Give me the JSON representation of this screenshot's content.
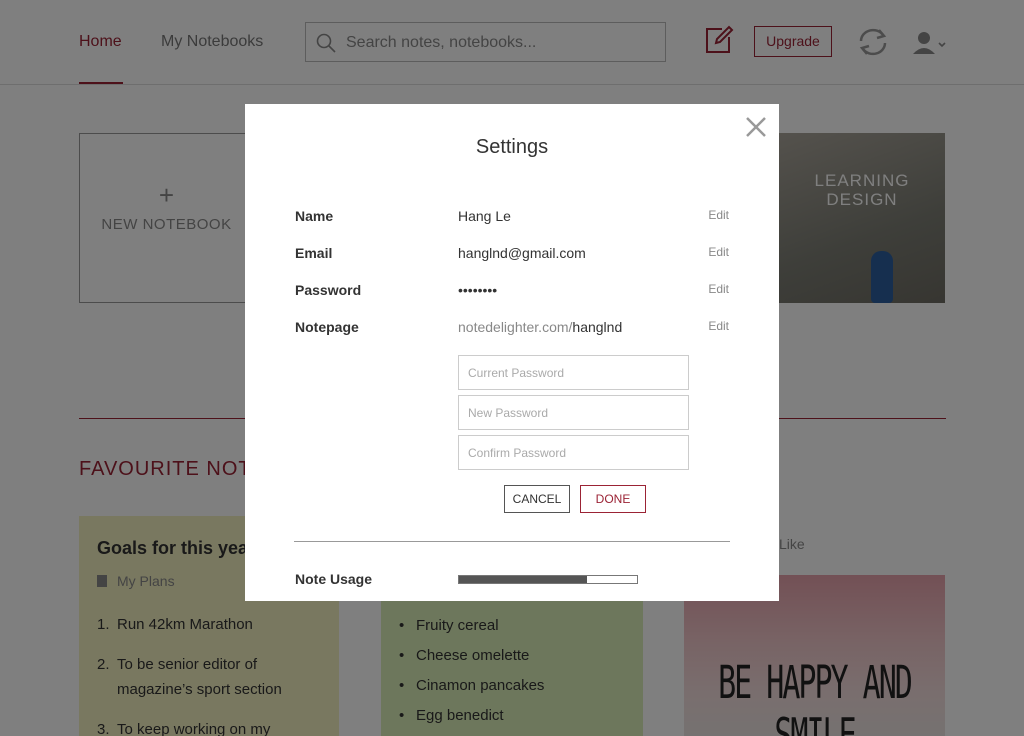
{
  "header": {
    "nav": {
      "home": "Home",
      "notebooks": "My Notebooks"
    },
    "search_placeholder": "Search notes, notebooks...",
    "upgrade_label": "Upgrade"
  },
  "notebooks": {
    "new_plus": "+",
    "new_label": "NEW NOTEBOOK",
    "learning_line1": "LEARNING",
    "learning_line2": "DESIGN"
  },
  "favourites": {
    "title": "FAVOURITE NOTE",
    "card1": {
      "title": "Goals for this year",
      "notebook": "My Plans",
      "items": [
        {
          "n": "1.",
          "text": "Run 42km Marathon"
        },
        {
          "n": "2.",
          "text": "To be senior editor of magazine’s  sport section"
        },
        {
          "n": "3.",
          "text": "To keep working on my"
        }
      ]
    },
    "card2": {
      "items": [
        "Fruity cereal",
        "Cheese omelette",
        "Cinamon pancakes",
        "Egg benedict"
      ]
    },
    "card3": {
      "like": "Like",
      "caption": "BE HAPPY AND SMILE"
    }
  },
  "settings": {
    "title": "Settings",
    "rows": {
      "name": {
        "label": "Name",
        "value": "Hang Le",
        "edit": "Edit"
      },
      "email": {
        "label": "Email",
        "value": "hanglnd@gmail.com",
        "edit": "Edit"
      },
      "password": {
        "label": "Password",
        "value": "••••••••",
        "edit": "Edit"
      },
      "notepage": {
        "label": "Notepage",
        "prefix": "notedelighter.com/",
        "value": "hanglnd",
        "edit": "Edit"
      }
    },
    "fields": {
      "current": "Current Password",
      "new": "New Password",
      "confirm": "Confirm Password"
    },
    "cancel_label": "CANCEL",
    "done_label": "DONE",
    "usage_label": "Note Usage",
    "usage_fraction": 0.72
  },
  "colors": {
    "accent": "#9b2335"
  }
}
